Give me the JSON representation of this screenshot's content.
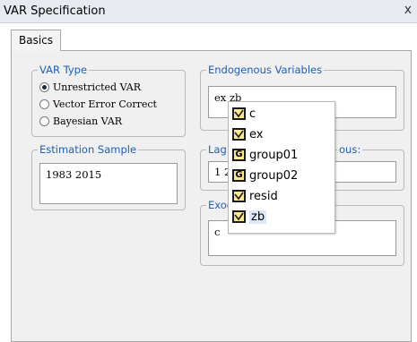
{
  "window": {
    "title": "VAR Specification",
    "close_glyph": "x"
  },
  "tabs": [
    {
      "label": "Basics",
      "active": true
    }
  ],
  "var_type": {
    "legend": "VAR Type",
    "options": [
      {
        "label": "Unrestricted VAR",
        "checked": true
      },
      {
        "label": "Vector Error Correct",
        "checked": false
      },
      {
        "label": "Bayesian VAR",
        "checked": false
      }
    ]
  },
  "endogenous": {
    "legend": "Endogenous Variables",
    "value": "ex zb"
  },
  "estimation_sample": {
    "legend": "Estimation Sample",
    "value": "1983 2015"
  },
  "lag_intervals": {
    "legend": "Lag",
    "legend_tail": "ous:",
    "value": "1 2"
  },
  "exogenous": {
    "legend": "Exog",
    "value": "c"
  },
  "autocomplete": {
    "items": [
      {
        "label": "c",
        "icon": "series-icon"
      },
      {
        "label": "ex",
        "icon": "series-icon"
      },
      {
        "label": "group01",
        "icon": "group-icon",
        "glyph": "G"
      },
      {
        "label": "group02",
        "icon": "group-icon",
        "glyph": "G"
      },
      {
        "label": "resid",
        "icon": "series-icon"
      },
      {
        "label": "zb",
        "icon": "series-icon",
        "selected": true
      }
    ]
  },
  "colors": {
    "legend": "#1f5eb0",
    "icon_fill": "#fde98a",
    "selection": "#dde7f6"
  }
}
